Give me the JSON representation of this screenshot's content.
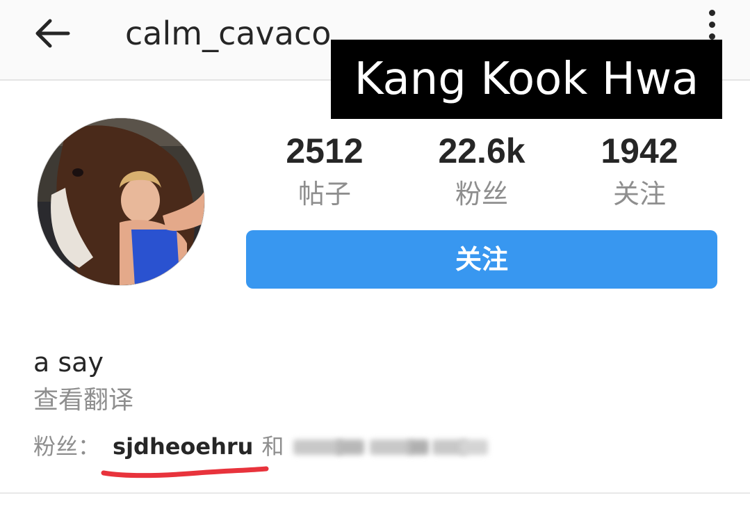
{
  "header": {
    "username": "calm_cavaco",
    "back_icon": "arrow-left-icon",
    "menu_icon": "more-vertical-icon"
  },
  "overlay_caption": "Kang Kook Hwa",
  "profile": {
    "avatar_icon": "profile-photo"
  },
  "stats": {
    "posts": {
      "value": "2512",
      "label": "帖子"
    },
    "followers": {
      "value": "22.6k",
      "label": "粉丝"
    },
    "following": {
      "value": "1942",
      "label": "关注"
    }
  },
  "follow_button": {
    "label": "关注",
    "color": "#3897f0"
  },
  "bio": {
    "text": "a say",
    "translate_label": "查看翻译"
  },
  "followed_by": {
    "label": "粉丝：",
    "user": "sjdheoehru",
    "conjunction": "和"
  },
  "colors": {
    "accent": "#3897f0",
    "annotation_underline": "#e8333c",
    "caption_bg": "#000000"
  }
}
